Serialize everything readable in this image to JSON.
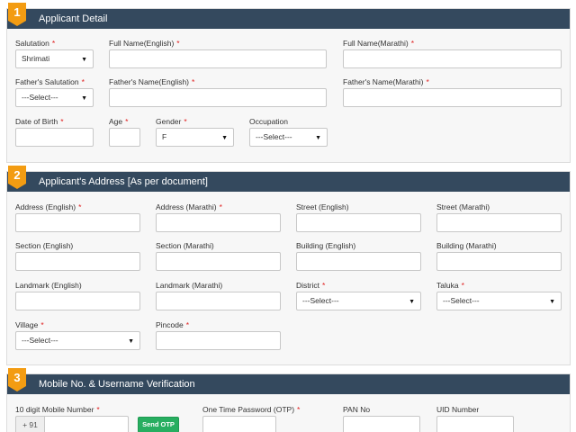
{
  "section1": {
    "number": "1",
    "title": "Applicant Detail",
    "salutation_label": "Salutation",
    "salutation_value": "Shrimati",
    "fullname_en_label": "Full Name(English)",
    "fullname_mr_label": "Full Name(Marathi)",
    "father_salutation_label": "Father's Salutation",
    "father_salutation_value": "---Select---",
    "father_name_en_label": "Father's Name(English)",
    "father_name_mr_label": "Father's Name(Marathi)",
    "dob_label": "Date of Birth",
    "age_label": "Age",
    "gender_label": "Gender",
    "gender_value": "F",
    "occupation_label": "Occupation",
    "occupation_value": "---Select---"
  },
  "section2": {
    "number": "2",
    "title": "Applicant's Address [As per document]",
    "address_en_label": "Address (English)",
    "address_mr_label": "Address (Marathi)",
    "street_en_label": "Street (English)",
    "street_mr_label": "Street (Marathi)",
    "section_en_label": "Section (English)",
    "section_mr_label": "Section (Marathi)",
    "building_en_label": "Building (English)",
    "building_mr_label": "Building (Marathi)",
    "landmark_en_label": "Landmark (English)",
    "landmark_mr_label": "Landmark (Marathi)",
    "district_label": "District",
    "district_value": "---Select---",
    "taluka_label": "Taluka",
    "taluka_value": "---Select---",
    "village_label": "Village",
    "village_value": "---Select---",
    "pincode_label": "Pincode"
  },
  "section3": {
    "number": "3",
    "title": "Mobile No. & Username Verification",
    "mobile_label": "10 digit Mobile Number",
    "mobile_prefix": "+ 91",
    "send_otp_label": "Send OTP",
    "otp_label": "One Time Password (OTP)",
    "pan_label": "PAN No",
    "uid_label": "UID Number"
  },
  "colors": {
    "header_bg": "#34495e",
    "badge": "#f39c12",
    "required": "#e02020",
    "otp_button": "#27ae60"
  }
}
